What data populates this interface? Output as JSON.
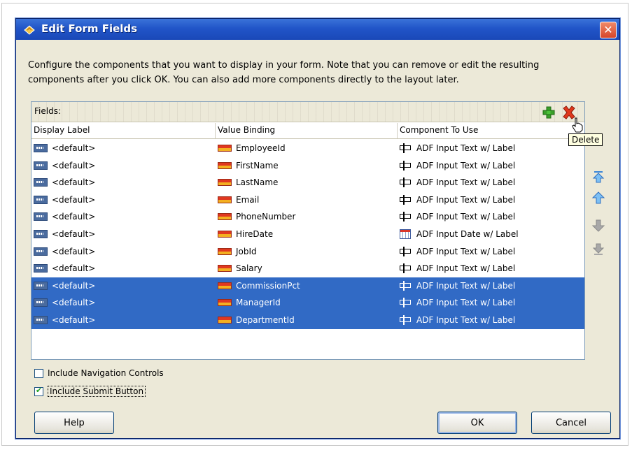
{
  "dialog": {
    "title": "Edit Form Fields",
    "close_glyph": "✕",
    "instructions_line1": "Configure the components that you want to display in your form.  Note that you can remove or edit the resulting",
    "instructions_line2": "components after you click OK.  You can also add more components directly to the layout later."
  },
  "fields": {
    "label": "Fields:",
    "tooltip": "Delete",
    "columns": [
      "Display Label",
      "Value Binding",
      "Component To Use"
    ],
    "rows": [
      {
        "label": "<default>",
        "binding": "EmployeeId",
        "component": "ADF Input Text w/ Label",
        "comp_icon": "input-text-icon",
        "selected": false
      },
      {
        "label": "<default>",
        "binding": "FirstName",
        "component": "ADF Input Text w/ Label",
        "comp_icon": "input-text-icon",
        "selected": false
      },
      {
        "label": "<default>",
        "binding": "LastName",
        "component": "ADF Input Text w/ Label",
        "comp_icon": "input-text-icon",
        "selected": false
      },
      {
        "label": "<default>",
        "binding": "Email",
        "component": "ADF Input Text w/ Label",
        "comp_icon": "input-text-icon",
        "selected": false
      },
      {
        "label": "<default>",
        "binding": "PhoneNumber",
        "component": "ADF Input Text w/ Label",
        "comp_icon": "input-text-icon",
        "selected": false
      },
      {
        "label": "<default>",
        "binding": "HireDate",
        "component": "ADF Input Date w/ Label",
        "comp_icon": "input-date-icon",
        "selected": false
      },
      {
        "label": "<default>",
        "binding": "JobId",
        "component": "ADF Input Text w/ Label",
        "comp_icon": "input-text-icon",
        "selected": false
      },
      {
        "label": "<default>",
        "binding": "Salary",
        "component": "ADF Input Text w/ Label",
        "comp_icon": "input-text-icon",
        "selected": false
      },
      {
        "label": "<default>",
        "binding": "CommissionPct",
        "component": "ADF Input Text w/ Label",
        "comp_icon": "input-text-icon",
        "selected": true
      },
      {
        "label": "<default>",
        "binding": "ManagerId",
        "component": "ADF Input Text w/ Label",
        "comp_icon": "input-text-icon",
        "selected": true
      },
      {
        "label": "<default>",
        "binding": "DepartmentId",
        "component": "ADF Input Text w/ Label",
        "comp_icon": "input-text-icon",
        "selected": true
      }
    ]
  },
  "options": {
    "navigation_controls": {
      "label": "Include Navigation Controls",
      "checked": false
    },
    "submit_button": {
      "label": "Include Submit Button",
      "checked": true
    }
  },
  "buttons": {
    "help": "Help",
    "ok": "OK",
    "cancel": "Cancel"
  },
  "colors": {
    "title_bar": "#2155c8",
    "selection": "#316ac5",
    "dialog_bg": "#ece9d8"
  }
}
